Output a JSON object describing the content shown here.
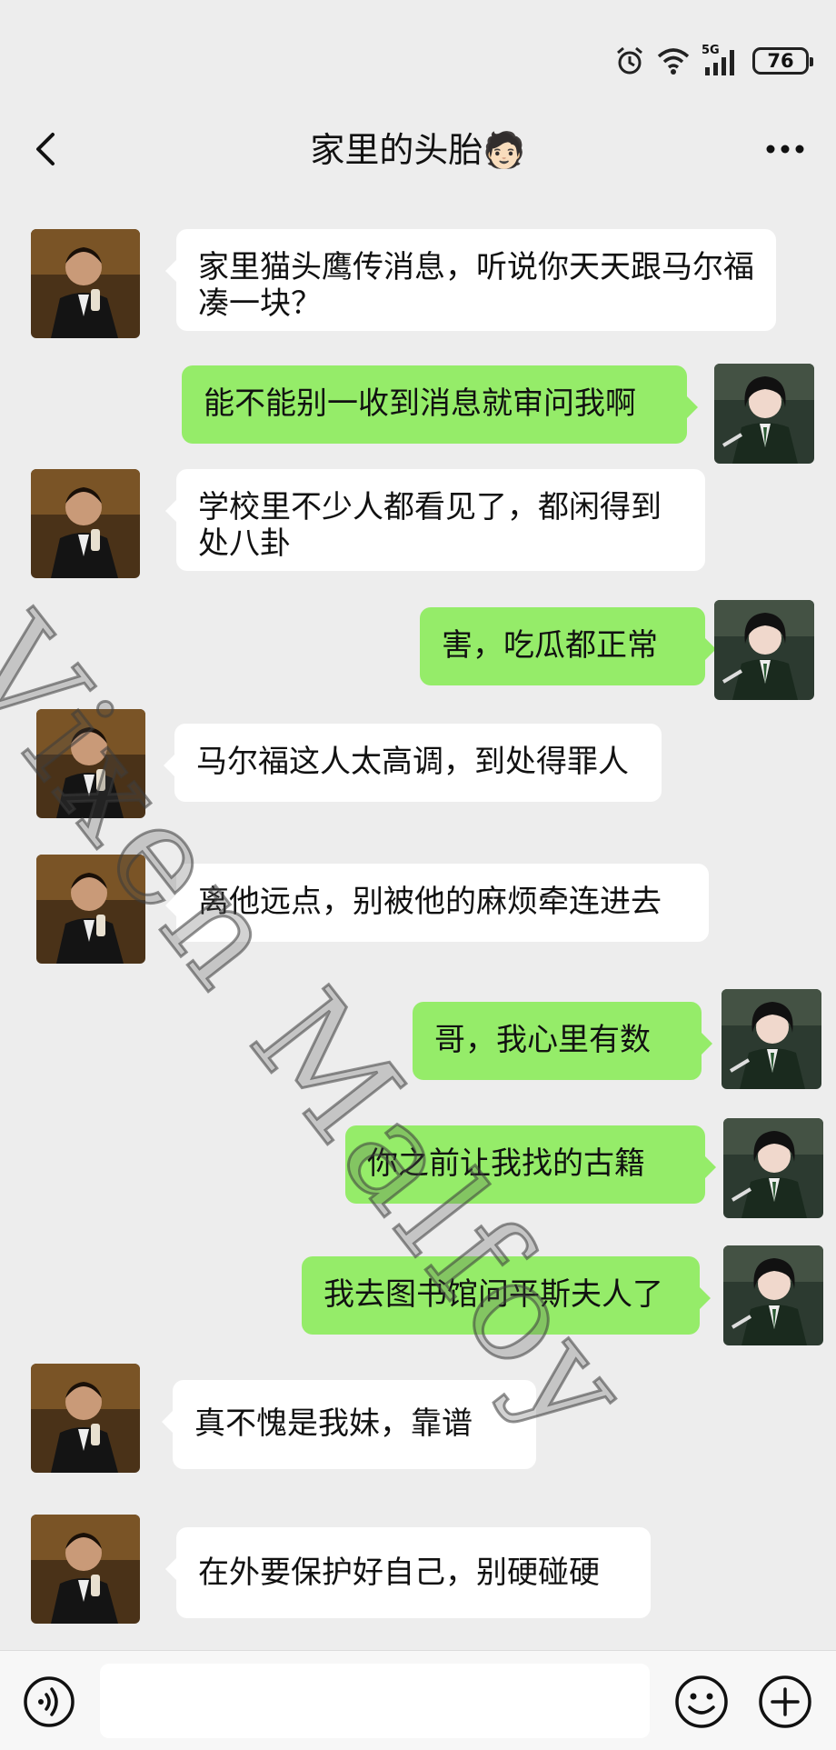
{
  "status_bar": {
    "network": "5G",
    "battery": "76"
  },
  "header": {
    "title": "家里的头胎",
    "title_emoji": "🧑🏻"
  },
  "messages": [
    {
      "side": "left",
      "avatar": "brother-avatar",
      "text": "家里猫头鹰传消息，听说你天天跟马尔福凑一块？"
    },
    {
      "side": "right",
      "avatar": "sister-avatar",
      "text": "能不能别一收到消息就审问我啊"
    },
    {
      "side": "left",
      "avatar": "brother-avatar",
      "text": "学校里不少人都看见了，都闲得到处八卦"
    },
    {
      "side": "right",
      "avatar": "sister-avatar",
      "text": "害，吃瓜都正常"
    },
    {
      "side": "left",
      "avatar": "brother-avatar",
      "text": "马尔福这人太高调，到处得罪人"
    },
    {
      "side": "left",
      "avatar": "brother-avatar",
      "text": "离他远点，别被他的麻烦牵连进去"
    },
    {
      "side": "right",
      "avatar": "sister-avatar",
      "text": "哥，我心里有数"
    },
    {
      "side": "right",
      "avatar": "sister-avatar",
      "text": "你之前让我找的古籍"
    },
    {
      "side": "right",
      "avatar": "sister-avatar",
      "text": "我去图书馆问平斯夫人了"
    },
    {
      "side": "left",
      "avatar": "brother-avatar",
      "text": "真不愧是我妹，靠谱"
    },
    {
      "side": "left",
      "avatar": "brother-avatar",
      "text": "在外要保护好自己，别硬碰硬"
    }
  ],
  "watermark": "Vixen Malfoy",
  "input_bar": {
    "voice_icon": "voice-icon",
    "emoji_icon": "emoji-icon",
    "plus_icon": "plus-icon"
  },
  "colors": {
    "background": "#ededed",
    "bubble_left": "#ffffff",
    "bubble_right": "#95ec69"
  }
}
